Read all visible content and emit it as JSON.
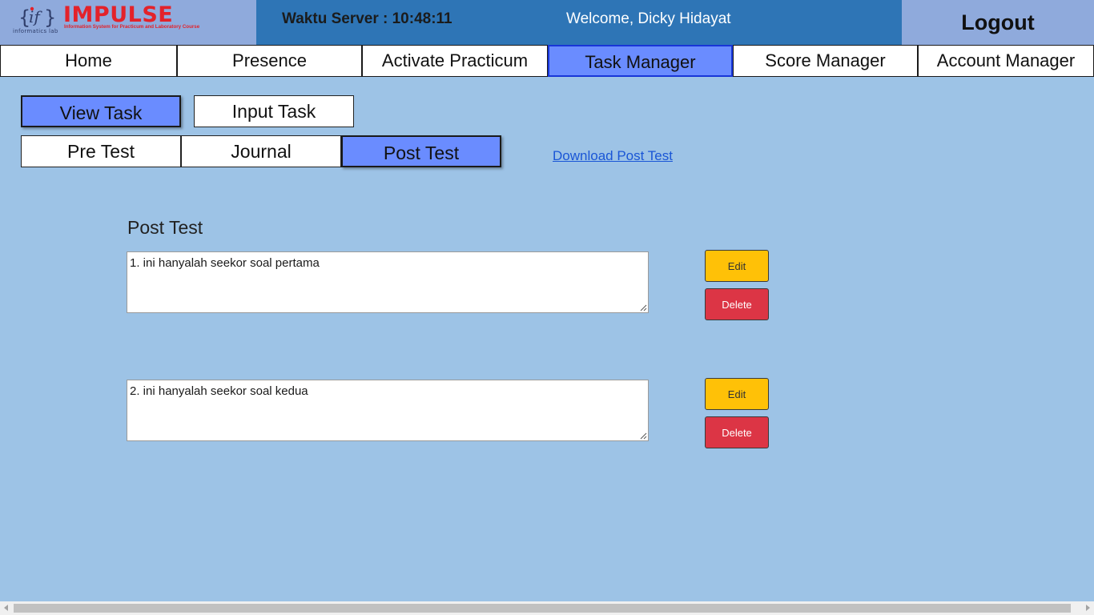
{
  "header": {
    "logo": {
      "mark_text": "{if}",
      "lab_text": "informatics lab",
      "title": "IMPULSE",
      "tagline": "Information System for Practicum and Laboratory Course",
      "brand_color": "#e3222a"
    },
    "server_time": "Waktu Server : 10:48:11",
    "welcome": "Welcome, Dicky Hidayat",
    "logout_label": "Logout"
  },
  "nav": {
    "items": [
      {
        "label": "Home"
      },
      {
        "label": "Presence"
      },
      {
        "label": "Activate Practicum"
      },
      {
        "label": "Task Manager"
      },
      {
        "label": "Score Manager"
      },
      {
        "label": "Account Manager"
      }
    ],
    "active": "Task Manager"
  },
  "task_mode": {
    "view_label": "View Task",
    "input_label": "Input Task",
    "active": "View Task"
  },
  "task_type": {
    "pre_label": "Pre Test",
    "journal_label": "Journal",
    "post_label": "Post Test",
    "active": "Post Test"
  },
  "download_link": "Download Post Test",
  "section_title": "Post Test",
  "questions": [
    {
      "text": "1. ini hanyalah seekor soal pertama",
      "edit_label": "Edit",
      "delete_label": "Delete"
    },
    {
      "text": "2. ini hanyalah seekor soal kedua",
      "edit_label": "Edit",
      "delete_label": "Delete"
    }
  ],
  "colors": {
    "header_bg": "#2e75b6",
    "logo_bg": "#8faadc",
    "page_bg": "#9dc3e6",
    "active_tab": "#6a8cff",
    "edit": "#ffc107",
    "delete": "#dc3545",
    "link": "#1a56d6"
  }
}
